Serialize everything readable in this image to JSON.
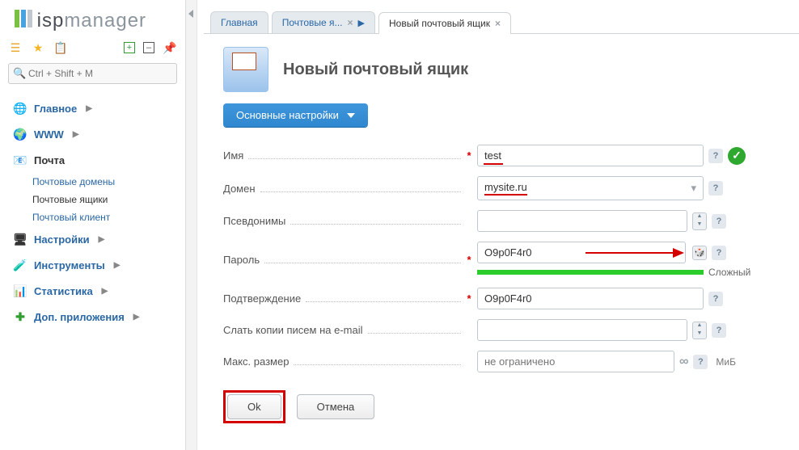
{
  "logo": {
    "prefix": "isp",
    "suffix": "manager"
  },
  "search": {
    "placeholder": "Ctrl + Shift + M"
  },
  "sidebar": {
    "items": [
      {
        "label": "Главное",
        "icon": "🌐"
      },
      {
        "label": "WWW",
        "icon": "🌍"
      },
      {
        "label": "Почта",
        "icon": "📧",
        "active": true,
        "children": [
          {
            "label": "Почтовые домены"
          },
          {
            "label": "Почтовые ящики",
            "active": true
          },
          {
            "label": "Почтовый клиент"
          }
        ]
      },
      {
        "label": "Настройки",
        "icon": "🖥"
      },
      {
        "label": "Инструменты",
        "icon": "🧪"
      },
      {
        "label": "Статистика",
        "icon": "📊"
      },
      {
        "label": "Доп. приложения",
        "icon": "➕"
      }
    ]
  },
  "tabs": [
    {
      "label": "Главная",
      "closable": false
    },
    {
      "label": "Почтовые я...",
      "closable": true,
      "chev": true
    },
    {
      "label": "Новый почтовый ящик",
      "closable": true,
      "active": true
    }
  ],
  "page_title": "Новый почтовый ящик",
  "section": "Основные настройки",
  "form": {
    "name": {
      "label": "Имя",
      "value": "test",
      "required": true
    },
    "domain": {
      "label": "Домен",
      "value": "mysite.ru"
    },
    "aliases": {
      "label": "Псевдонимы",
      "value": ""
    },
    "password": {
      "label": "Пароль",
      "value": "O9p0F4r0",
      "required": true,
      "strength": "Сложный"
    },
    "confirm": {
      "label": "Подтверждение",
      "value": "O9p0F4r0",
      "required": true
    },
    "cc": {
      "label": "Слать копии писем на e-mail",
      "value": ""
    },
    "size": {
      "label": "Макс. размер",
      "placeholder": "не ограничено",
      "unit": "МиБ"
    }
  },
  "buttons": {
    "ok": "Ok",
    "cancel": "Отмена"
  }
}
